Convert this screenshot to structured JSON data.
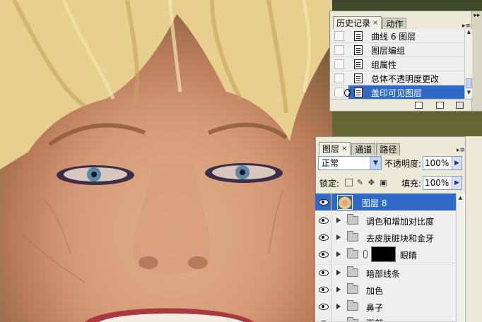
{
  "history_panel": {
    "tabs": [
      {
        "label": "历史记录",
        "close": "×"
      },
      {
        "label": "动作"
      }
    ],
    "menu_glyph": "▸≡",
    "collapse_glyph": "▸▸",
    "items": [
      {
        "label": "曲线 6 图层",
        "selected": false
      },
      {
        "label": "图层编组",
        "selected": false
      },
      {
        "label": "组属性",
        "selected": false
      },
      {
        "label": "总体不透明度更改",
        "selected": false
      },
      {
        "label": "盖印可见图层",
        "selected": true
      }
    ]
  },
  "layers_panel": {
    "tabs": [
      {
        "label": "图层",
        "close": "×"
      },
      {
        "label": "通道"
      },
      {
        "label": "路径"
      }
    ],
    "menu_glyph": "▸≡",
    "blend_mode": "正常",
    "opacity_label": "不透明度:",
    "opacity_value": "100%",
    "lock_label": "锁定:",
    "fill_label": "填充:",
    "fill_value": "100%",
    "layers": [
      {
        "name": "图层 8",
        "kind": "pixel",
        "selected": true
      },
      {
        "name": "调色和增加对比度",
        "kind": "group"
      },
      {
        "name": "去皮肤脏块和金牙",
        "kind": "group"
      },
      {
        "name": "眼睛",
        "kind": "group-mask"
      },
      {
        "name": "暗部线条",
        "kind": "group"
      },
      {
        "name": "加色",
        "kind": "group"
      },
      {
        "name": "鼻子",
        "kind": "group"
      },
      {
        "name": "面部",
        "kind": "group"
      }
    ]
  },
  "colors": {
    "selection": "#3169c6",
    "panel_bg": "#ece9d8"
  }
}
